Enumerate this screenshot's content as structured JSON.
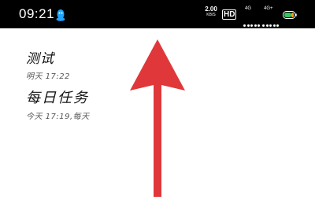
{
  "status_bar": {
    "time": "09:21",
    "net_speed_value": "2.00",
    "net_speed_unit": "KB/S",
    "hd_label": "HD",
    "sim1_label": "4G",
    "sim2_label": "4G+",
    "icons": [
      "qq-penguin-icon",
      "signal-icon",
      "signal-icon",
      "battery-icon"
    ]
  },
  "tasks": [
    {
      "title": "测试",
      "subtitle": "明天 17:22"
    },
    {
      "title": "每日任务",
      "subtitle": "今天 17:19,每天"
    }
  ],
  "overlay": {
    "arrow_color": "#e0383a",
    "arrow_direction": "up"
  }
}
